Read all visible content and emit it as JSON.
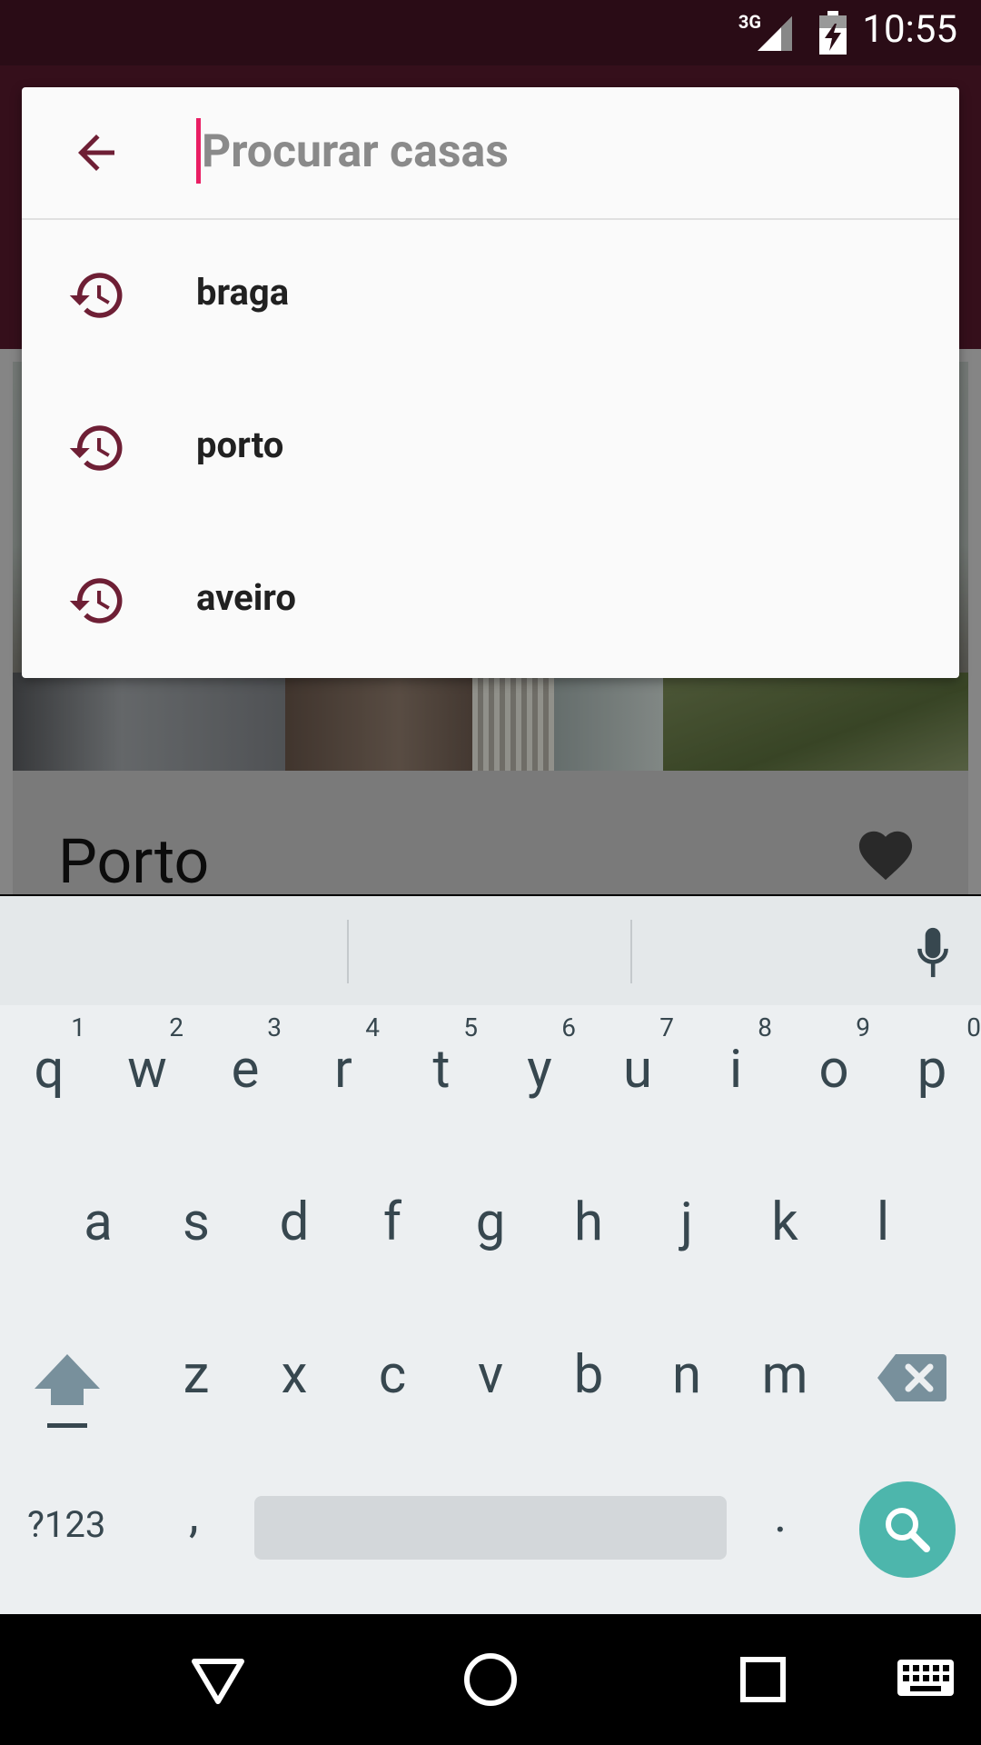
{
  "status": {
    "network": "3G",
    "time": "10:55"
  },
  "search": {
    "placeholder": "Procurar casas",
    "value": ""
  },
  "suggestions": [
    {
      "label": "braga"
    },
    {
      "label": "porto"
    },
    {
      "label": "aveiro"
    }
  ],
  "listing": {
    "title": "Porto"
  },
  "keyboard": {
    "row1": [
      {
        "ch": "q",
        "num": "1"
      },
      {
        "ch": "w",
        "num": "2"
      },
      {
        "ch": "e",
        "num": "3"
      },
      {
        "ch": "r",
        "num": "4"
      },
      {
        "ch": "t",
        "num": "5"
      },
      {
        "ch": "y",
        "num": "6"
      },
      {
        "ch": "u",
        "num": "7"
      },
      {
        "ch": "i",
        "num": "8"
      },
      {
        "ch": "o",
        "num": "9"
      },
      {
        "ch": "p",
        "num": "0"
      }
    ],
    "row2": [
      "a",
      "s",
      "d",
      "f",
      "g",
      "h",
      "j",
      "k",
      "l"
    ],
    "row3": [
      "z",
      "x",
      "c",
      "v",
      "b",
      "n",
      "m"
    ],
    "symbols": "?123",
    "comma": ",",
    "period": "."
  },
  "colors": {
    "accent": "#6e1f35",
    "status_bar": "#2a0c16",
    "app_bar": "#4a1626",
    "cursor": "#e91e63",
    "keyboard_go": "#4db6ac"
  },
  "icons": {
    "back": "arrow-back-icon",
    "history": "history-icon",
    "favorite": "heart-icon",
    "mic": "mic-icon",
    "shift": "shift-icon",
    "backspace": "backspace-icon",
    "go": "search-icon",
    "nav_back": "triangle-back-icon",
    "nav_home": "circle-home-icon",
    "nav_recents": "square-recents-icon",
    "nav_keyboard": "keyboard-icon"
  }
}
